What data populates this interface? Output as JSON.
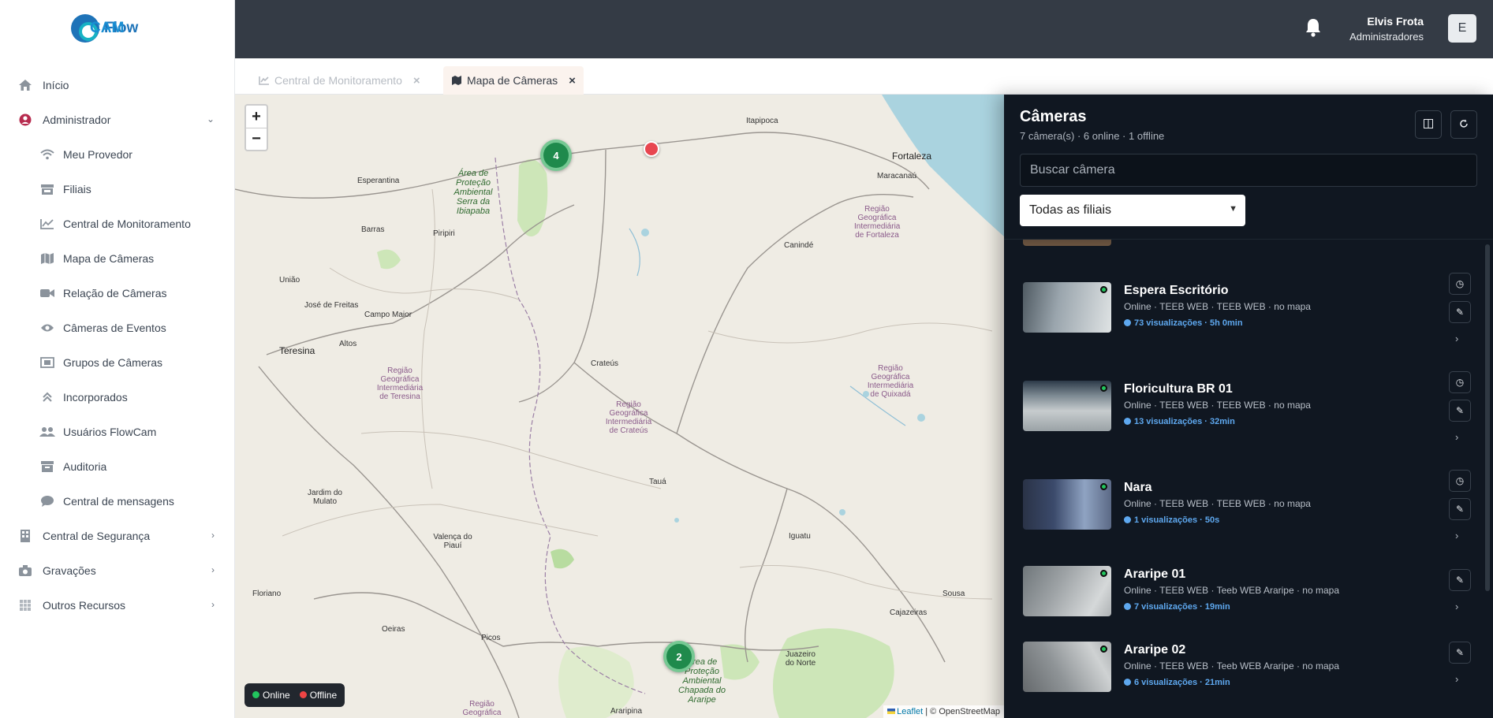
{
  "brand": {
    "name_part1": "Flow",
    "name_part2": "CAM"
  },
  "sidebar": {
    "items": [
      {
        "label": "Início",
        "icon": "home-icon"
      },
      {
        "label": "Administrador",
        "icon": "user-circle-icon"
      },
      {
        "label": "Meu Provedor",
        "icon": "wifi-icon"
      },
      {
        "label": "Filiais",
        "icon": "store-icon"
      },
      {
        "label": "Central de Monitoramento",
        "icon": "chart-line-icon"
      },
      {
        "label": "Mapa de Câmeras",
        "icon": "map-icon"
      },
      {
        "label": "Relação de Câmeras",
        "icon": "video-icon"
      },
      {
        "label": "Câmeras de Eventos",
        "icon": "eye-icon"
      },
      {
        "label": "Grupos de Câmeras",
        "icon": "group-icon"
      },
      {
        "label": "Incorporados",
        "icon": "double-chevron-up-icon"
      },
      {
        "label": "Usuários FlowCam",
        "icon": "users-icon"
      },
      {
        "label": "Auditoria",
        "icon": "archive-icon"
      },
      {
        "label": "Central de mensagens",
        "icon": "comment-icon"
      },
      {
        "label": "Central de Segurança",
        "icon": "building-icon"
      },
      {
        "label": "Gravações",
        "icon": "camera-icon"
      },
      {
        "label": "Outros Recursos",
        "icon": "grid-icon"
      }
    ]
  },
  "header": {
    "user_name": "Elvis Frota",
    "user_role": "Administradores",
    "avatar_initial": "E",
    "notification_icon": "bell-icon"
  },
  "tabs": [
    {
      "label": "Central de Monitoramento",
      "icon": "chart-line-icon",
      "close": "×"
    },
    {
      "label": "Mapa de Câmeras",
      "icon": "map-icon",
      "close": "×"
    }
  ],
  "map": {
    "zoom_in": "+",
    "zoom_out": "−",
    "clusters": [
      "4",
      "2"
    ],
    "legend": {
      "online": "Online",
      "offline": "Offline",
      "online_color": "#22c55e",
      "offline_color": "#ef4444"
    },
    "attribution": {
      "leaflet": "Leaflet",
      "rest": "| © OpenStreetMap"
    },
    "places": {
      "itapipoca": "Itapipoca",
      "fortaleza": "Fortaleza",
      "maracanau": "Maracanaú",
      "esperantina": "Esperantina",
      "barras": "Barras",
      "piripiri": "Piripiri",
      "caninde": "Canindé",
      "uniao": "União",
      "jose_de_freitas": "José de Freitas",
      "campo_maior": "Campo Maior",
      "teresina": "Teresina",
      "altos": "Altos",
      "crateus": "Crateús",
      "taua": "Tauá",
      "iguatu": "Iguatu",
      "jardim_do_mulato": "Jardim do Mulato",
      "valenca_do_piaui": "Valença do Piauí",
      "floriano": "Floriano",
      "oeiras": "Oeiras",
      "picos": "Picos",
      "sousa": "Sousa",
      "cajazeiras": "Cajazeiras",
      "juazeiro_do_norte": "Juazeiro do Norte",
      "araripina": "Araripina",
      "regiao_fortaleza": "Região Geográfica Intermediária de Fortaleza",
      "regiao_teresina": "Região Geográfica Intermediária de Teresina",
      "regiao_crateus": "Região Geográfica Intermediária de Crateús",
      "regiao_quixada": "Região Geográfica Intermediária de Quixadá",
      "regiao_bottom": "Região Geográfica",
      "apa_ibiapaba": "Área de Proteção Ambiental Serra da Ibiapaba",
      "apa_araripe": "Área de Proteção Ambiental Chapada do Araripe"
    }
  },
  "panel": {
    "title": "Câmeras",
    "subtitle": "7 câmera(s) · 6 online · 1 offline",
    "columns_icon": "columns-icon",
    "refresh_icon": "refresh-icon",
    "search_placeholder": "Buscar câmera",
    "filter_selected": "Todas as filiais",
    "cameras": [
      {
        "name": "Espera Escritório",
        "meta": "Online · TEEB WEB · TEEB WEB · no mapa",
        "views": "73 visualizações · 5h 0min",
        "thumb": [
          "#9aa5ad",
          "#dfe3e4"
        ]
      },
      {
        "name": "Floricultura BR 01",
        "meta": "Online · TEEB WEB · TEEB WEB · no mapa",
        "views": "13 visualizações · 32min",
        "thumb": [
          "#7d8a93",
          "#c7ccce"
        ]
      },
      {
        "name": "Nara",
        "meta": "Online · TEEB WEB · TEEB WEB · no mapa",
        "views": "1 visualizações · 50s",
        "thumb": [
          "#3b4a6b",
          "#8fa3c2"
        ]
      },
      {
        "name": "Araripe 01",
        "meta": "Online · TEEB WEB · Teeb WEB Araripe · no mapa",
        "views": "7 visualizações · 19min",
        "thumb": [
          "#9ea3a6",
          "#d5d8d9"
        ]
      },
      {
        "name": "Araripe 02",
        "meta": "Online · TEEB WEB · Teeb WEB Araripe · no mapa",
        "views": "6 visualizações · 21min",
        "thumb": [
          "#8f9497",
          "#cfd2d3"
        ]
      }
    ]
  }
}
